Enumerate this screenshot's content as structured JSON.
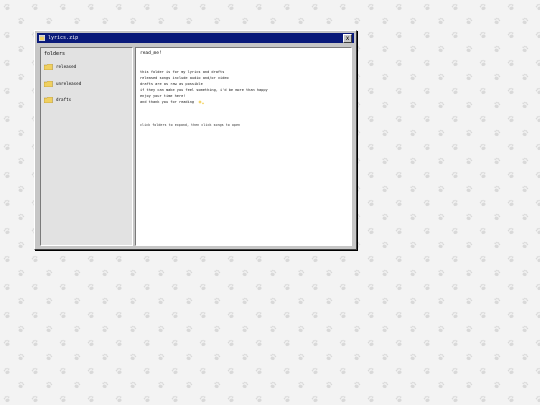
{
  "window": {
    "title": "lyrics.zip",
    "close_glyph": "x"
  },
  "sidebar": {
    "heading": "folders",
    "items": [
      {
        "label": "released",
        "icon": "folder-icon"
      },
      {
        "label": "unreleased",
        "icon": "folder-icon"
      },
      {
        "label": "drafts",
        "icon": "folder-icon"
      }
    ]
  },
  "content": {
    "title": "read_me!",
    "lines": [
      "this folder is for my lyrics and drafts",
      "released songs include audio and/or video",
      "drafts are as raw as possible",
      "if they can make you feel something, i'd be more than happy",
      "enjoy your time here!",
      "and thank you for reading"
    ],
    "hint": "click folders to expand, then click songs to open"
  },
  "colors": {
    "titlebar": "#0a1a7a",
    "window_bg": "#c6c6c6",
    "folder": "#f0d060",
    "desktop": "#f3f3f3",
    "paw": "#d9d9d9"
  }
}
